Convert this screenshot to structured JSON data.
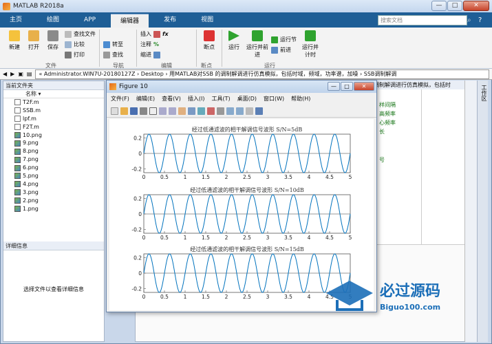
{
  "window": {
    "title": "MATLAB R2018a",
    "minimize": "—",
    "maximize": "□",
    "close": "✕"
  },
  "tabs": [
    "主页",
    "绘图",
    "APP",
    "编辑器",
    "发布",
    "视图"
  ],
  "active_tab": "编辑器",
  "search": {
    "placeholder": "搜索文档"
  },
  "ribbon": {
    "new": "新建",
    "open": "打开",
    "save": "保存",
    "find_files": "查找文件",
    "compare": "比较",
    "print": "打印",
    "goto": "转至",
    "find": "查找",
    "insert": "插入",
    "comment": "注释",
    "indent": "缩进",
    "breakpoints": "断点",
    "run": "运行",
    "run_advance": "运行并前进",
    "run_section": "运行节",
    "advance": "前进",
    "run_time": "运行并计时",
    "group_file": "文件",
    "group_nav": "导航",
    "group_edit": "编辑",
    "group_breakpoints": "断点",
    "group_run": "运行"
  },
  "address": {
    "path": "« Administrator.WIN7U-20180127Z › Desktop › 用MATLAB对SSB 的调制解调进行仿真模拟，包括时域，频域，功率谱，加噪 › SSB调制解调"
  },
  "left_panel": {
    "header": "当前文件夹",
    "column": "名称 ▾",
    "files": [
      {
        "name": "T2F.m",
        "type": "m"
      },
      {
        "name": "SSB.m",
        "type": "m"
      },
      {
        "name": "lpf.m",
        "type": "m"
      },
      {
        "name": "F2T.m",
        "type": "m"
      },
      {
        "name": "10.png",
        "type": "png"
      },
      {
        "name": "9.png",
        "type": "png"
      },
      {
        "name": "8.png",
        "type": "png"
      },
      {
        "name": "7.png",
        "type": "png"
      },
      {
        "name": "6.png",
        "type": "png"
      },
      {
        "name": "5.png",
        "type": "png"
      },
      {
        "name": "4.png",
        "type": "png"
      },
      {
        "name": "3.png",
        "type": "png"
      },
      {
        "name": "2.png",
        "type": "png"
      },
      {
        "name": "1.png",
        "type": "png"
      }
    ],
    "details_header": "详细信息",
    "details_text": "选择文件以查看详细信息"
  },
  "background_editor": {
    "tab_text": "调制解调进行仿真模拟，包括时",
    "lines": [
      "样间隔",
      "高频率",
      "心频率",
      "长",
      "号"
    ]
  },
  "workspace_label": "工作区",
  "figure": {
    "title": "Figure 10",
    "menu": [
      "文件(F)",
      "编辑(E)",
      "查看(V)",
      "插入(I)",
      "工具(T)",
      "桌面(D)",
      "窗口(W)",
      "帮助(H)"
    ]
  },
  "chart_data": [
    {
      "type": "line",
      "title": "经过低通滤波的相干解调信号波形 S/N=5dB",
      "x_range": [
        0,
        5
      ],
      "ylim": [
        -0.25,
        0.25
      ],
      "xticks": [
        "0",
        "0.5",
        "1",
        "1.5",
        "2",
        "2.5",
        "3",
        "3.5",
        "4",
        "4.5",
        "5"
      ],
      "yticks": [
        "0.2",
        "0",
        "-0.2"
      ],
      "series": [
        {
          "amplitude": 0.25,
          "frequency": 2,
          "color": "#0072bd"
        }
      ]
    },
    {
      "type": "line",
      "title": "经过低通滤波的相干解调信号波形 S/N=10dB",
      "x_range": [
        0,
        5
      ],
      "ylim": [
        -0.25,
        0.25
      ],
      "xticks": [
        "0",
        "0.5",
        "1",
        "1.5",
        "2",
        "2.5",
        "3",
        "3.5",
        "4",
        "4.5",
        "5"
      ],
      "yticks": [
        "0.2",
        "0",
        "-0.2"
      ],
      "series": [
        {
          "amplitude": 0.25,
          "frequency": 2,
          "color": "#0072bd"
        }
      ]
    },
    {
      "type": "line",
      "title": "经过低通滤波的相干解调信号波形 S/N=15dB",
      "x_range": [
        0,
        5
      ],
      "ylim": [
        -0.25,
        0.25
      ],
      "xticks": [
        "0",
        "0.5",
        "1",
        "1.5",
        "2",
        "2.5",
        "3",
        "3.5",
        "4",
        "4.5",
        "5"
      ],
      "yticks": [
        "0.2",
        "0",
        "-0.2"
      ],
      "series": [
        {
          "amplitude": 0.25,
          "frequency": 2,
          "color": "#0072bd"
        }
      ]
    }
  ],
  "watermark": {
    "brand": "必过源码",
    "url": "Biguo100.com"
  }
}
